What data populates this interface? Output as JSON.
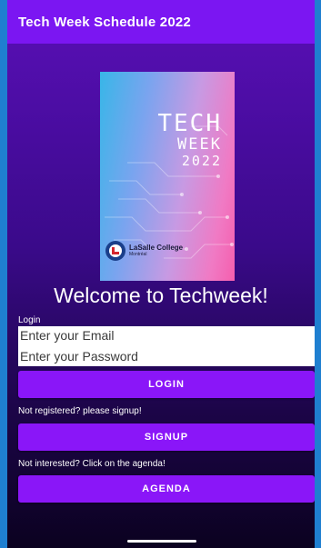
{
  "app": {
    "title": "Tech Week Schedule 2022"
  },
  "poster": {
    "line1": "TECH",
    "line2": "WEEK",
    "line3": "2022",
    "school_name": "LaSalle College",
    "school_city": "Montréal"
  },
  "welcome": "Welcome to Techweek!",
  "login": {
    "label": "Login",
    "email_placeholder": "Enter your Email",
    "password_placeholder": "Enter your Password",
    "login_button": "LOGIN"
  },
  "signup": {
    "note": "Not registered? please signup!",
    "button": "SIGNUP"
  },
  "agenda": {
    "note": "Not interested? Click on the agenda!",
    "button": "AGENDA"
  },
  "colors": {
    "appbar": "#7b16f2",
    "button": "#8a16f8",
    "background_top": "#5a0fb8",
    "background_bottom": "#0b0220"
  }
}
